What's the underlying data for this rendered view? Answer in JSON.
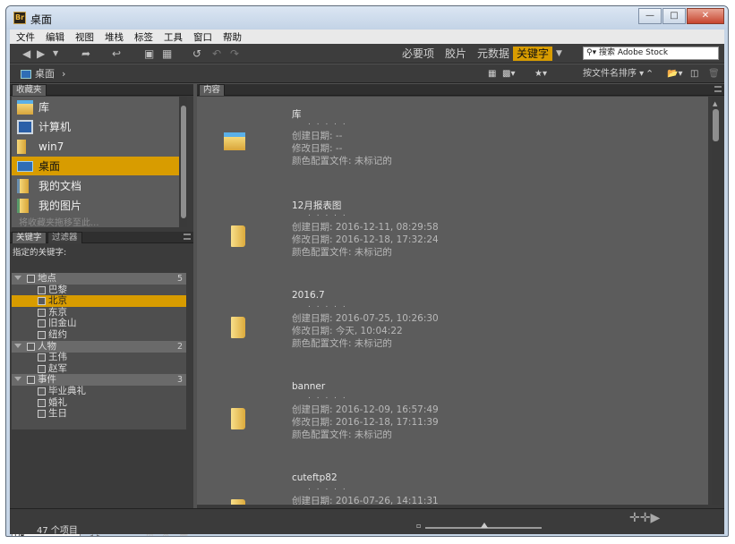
{
  "window": {
    "title": "桌面",
    "app_icon": "Br"
  },
  "menu": [
    "文件",
    "编辑",
    "视图",
    "堆栈",
    "标签",
    "工具",
    "窗口",
    "帮助"
  ],
  "workspaces": [
    {
      "label": "必要项",
      "active": false
    },
    {
      "label": "胶片",
      "active": false
    },
    {
      "label": "元数据",
      "active": false
    },
    {
      "label": "关键字",
      "active": true
    }
  ],
  "search": {
    "placeholder": "搜索 Adobe Stock"
  },
  "path": {
    "current": "桌面"
  },
  "sort": {
    "label": "按文件名排序"
  },
  "favorites": {
    "tab": "收藏夹",
    "items": [
      {
        "label": "库",
        "icon": "library-folder-icon",
        "selected": false
      },
      {
        "label": "计算机",
        "icon": "computer-icon",
        "selected": false
      },
      {
        "label": "win7",
        "icon": "folder-icon",
        "selected": false
      },
      {
        "label": "桌面",
        "icon": "desktop-icon",
        "selected": true
      },
      {
        "label": "我的文档",
        "icon": "documents-icon",
        "selected": false
      },
      {
        "label": "我的图片",
        "icon": "pictures-icon",
        "selected": false
      }
    ],
    "hint": "将收藏夹拖移至此..."
  },
  "keywords": {
    "tabs": [
      "关键字",
      "过滤器"
    ],
    "assigned_label": "指定的关键字:",
    "tree": [
      {
        "label": "地点",
        "count": "5",
        "level": 0,
        "selected": false
      },
      {
        "label": "巴黎",
        "count": "",
        "level": 1,
        "selected": false
      },
      {
        "label": "北京",
        "count": "",
        "level": 1,
        "selected": true
      },
      {
        "label": "东京",
        "count": "",
        "level": 1,
        "selected": false
      },
      {
        "label": "旧金山",
        "count": "",
        "level": 1,
        "selected": false
      },
      {
        "label": "纽约",
        "count": "",
        "level": 1,
        "selected": false
      },
      {
        "label": "人物",
        "count": "2",
        "level": 0,
        "selected": false
      },
      {
        "label": "王伟",
        "count": "",
        "level": 1,
        "selected": false
      },
      {
        "label": "赵军",
        "count": "",
        "level": 1,
        "selected": false
      },
      {
        "label": "事件",
        "count": "3",
        "level": 0,
        "selected": false
      },
      {
        "label": "毕业典礼",
        "count": "",
        "level": 1,
        "selected": false
      },
      {
        "label": "婚礼",
        "count": "",
        "level": 1,
        "selected": false
      },
      {
        "label": "生日",
        "count": "",
        "level": 1,
        "selected": false
      }
    ]
  },
  "content": {
    "tab": "内容",
    "items": [
      {
        "name": "库",
        "dots": ". . . . .",
        "created": "创建日期: --",
        "modified": "修改日期: --",
        "color": "颜色配置文件: 未标记的",
        "icon": "library-folder-icon"
      },
      {
        "name": "12月报表图",
        "dots": ". . . . .",
        "created": "创建日期: 2016-12-11, 08:29:58",
        "modified": "修改日期: 2016-12-18, 17:32:24",
        "color": "颜色配置文件: 未标记的",
        "icon": "folder-icon"
      },
      {
        "name": "2016.7",
        "dots": ". . . . .",
        "created": "创建日期: 2016-07-25, 10:26:30",
        "modified": "修改日期: 今天, 10:04:22",
        "color": "颜色配置文件: 未标记的",
        "icon": "folder-icon"
      },
      {
        "name": "banner",
        "dots": ". . . . .",
        "created": "创建日期: 2016-12-09, 16:57:49",
        "modified": "修改日期: 2016-12-18, 17:11:39",
        "color": "颜色配置文件: 未标记的",
        "icon": "folder-icon"
      },
      {
        "name": "cuteftp82",
        "dots": ". . . . .",
        "created": "创建日期: 2016-07-26, 14:11:31",
        "modified": "",
        "color": "",
        "icon": "folder-icon"
      }
    ]
  },
  "status": {
    "count": "47 个项目"
  },
  "colors": {
    "accent": "#d89c00",
    "panel": "#5c5c5c",
    "chrome": "#3b3b3b"
  }
}
